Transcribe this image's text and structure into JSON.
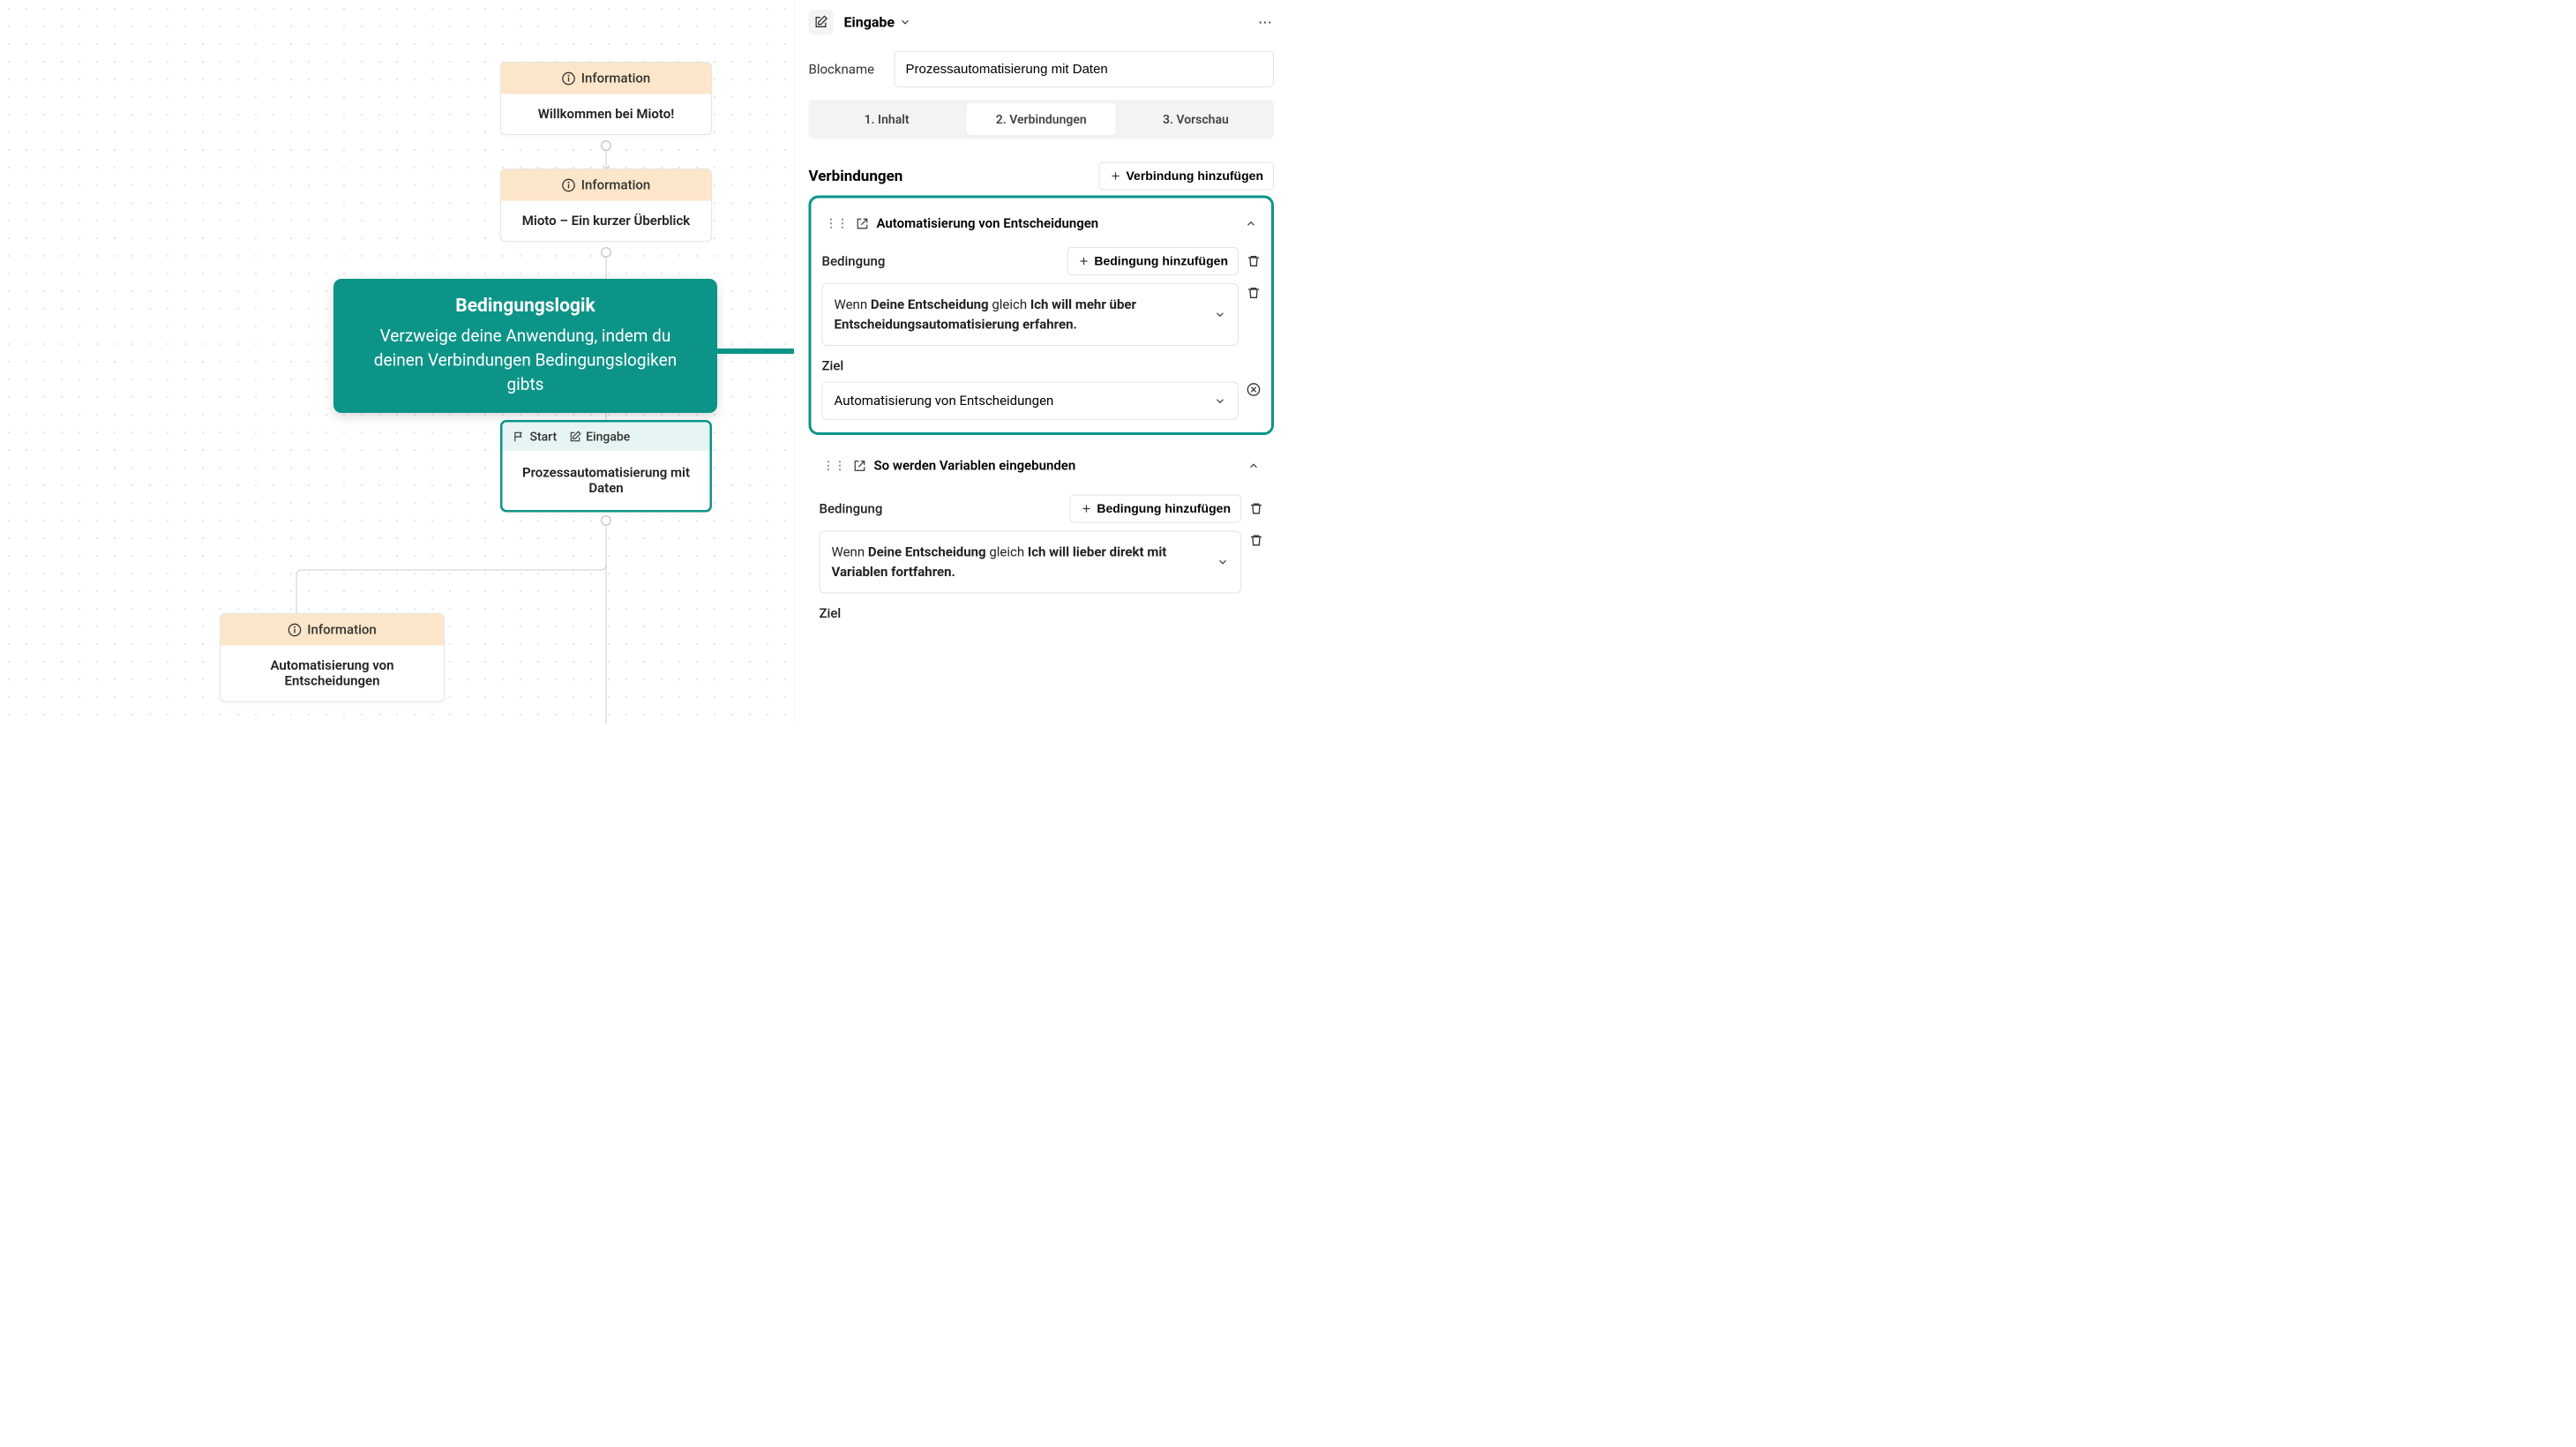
{
  "canvas": {
    "nodes": {
      "n1": {
        "type_label": "Information",
        "body": "Willkommen bei Mioto!"
      },
      "n2": {
        "type_label": "Information",
        "body": "Mioto – Ein kurzer Überblick"
      },
      "n3": {
        "start_tag": "Start",
        "input_tag": "Eingabe",
        "body": "Prozessautomatisierung mit Daten"
      },
      "n4": {
        "type_label": "Information",
        "body": "Automatisierung von Entscheidungen"
      }
    },
    "callout": {
      "title": "Bedingungslogik",
      "text": "Verzweige deine Anwendung, indem du deinen Verbindungen Bedingungslogiken gibts"
    }
  },
  "panel": {
    "type_label": "Eingabe",
    "blockname_label": "Blockname",
    "blockname_value": "Prozessautomatisierung mit Daten",
    "tabs": {
      "t1": "1. Inhalt",
      "t2": "2. Verbindungen",
      "t3": "3. Vorschau"
    },
    "connections": {
      "title": "Verbindungen",
      "add_btn": "Verbindung hinzufügen",
      "items": [
        {
          "title": "Automatisierung von Entscheidungen",
          "condition_label": "Bedingung",
          "add_condition_btn": "Bedingung hinzufügen",
          "cond_prefix": "Wenn ",
          "cond_var": "Deine Entscheidung",
          "cond_op": " gleich ",
          "cond_val": "Ich will mehr über Entscheidungsautomatisierung erfahren.",
          "target_label": "Ziel",
          "target_value": "Automatisierung von Entscheidungen"
        },
        {
          "title": "So werden Variablen eingebunden",
          "condition_label": "Bedingung",
          "add_condition_btn": "Bedingung hinzufügen",
          "cond_prefix": "Wenn ",
          "cond_var": "Deine Entscheidung",
          "cond_op": " gleich ",
          "cond_val": "Ich will lieber direkt mit Variablen fortfahren.",
          "target_label": "Ziel"
        }
      ]
    }
  }
}
